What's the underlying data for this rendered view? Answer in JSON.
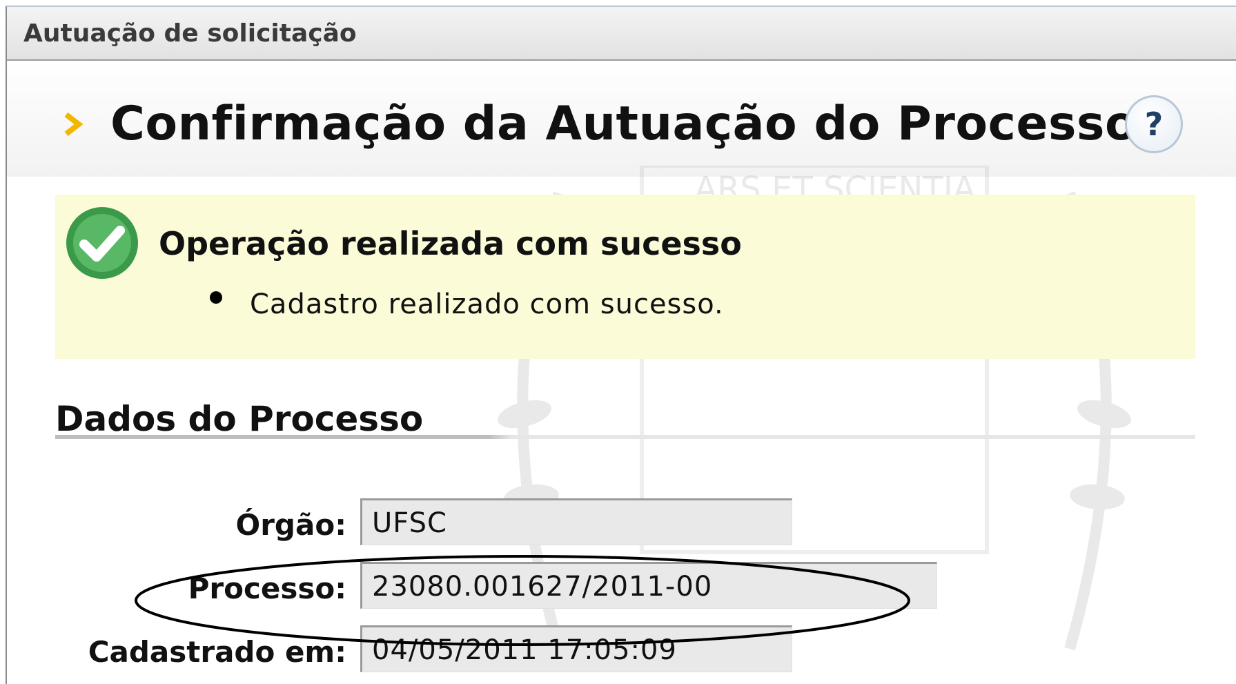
{
  "window": {
    "title": "Autuação de solicitação"
  },
  "page": {
    "title": "Confirmação da Autuação do Processo",
    "help_label": "?"
  },
  "message": {
    "title": "Operação realizada com sucesso",
    "items": [
      "Cadastro realizado com sucesso."
    ]
  },
  "watermark": {
    "motto": "ARS ET SCIENTIA"
  },
  "section": {
    "title": "Dados do Processo"
  },
  "fields": [
    {
      "label": "Órgão:",
      "value": "UFSC"
    },
    {
      "label": "Processo:",
      "value": "23080.001627/2011-00"
    },
    {
      "label": "Cadastrado em:",
      "value": "04/05/2011 17:05:09"
    }
  ],
  "colors": {
    "message_bg": "#fbfbd8",
    "success_green": "#3a9a4a",
    "title_arrow": "#f2b700",
    "field_bg": "#e9e9e9"
  },
  "icons": [
    "chevron-right-icon",
    "checkmark-circle-icon",
    "help-icon"
  ]
}
